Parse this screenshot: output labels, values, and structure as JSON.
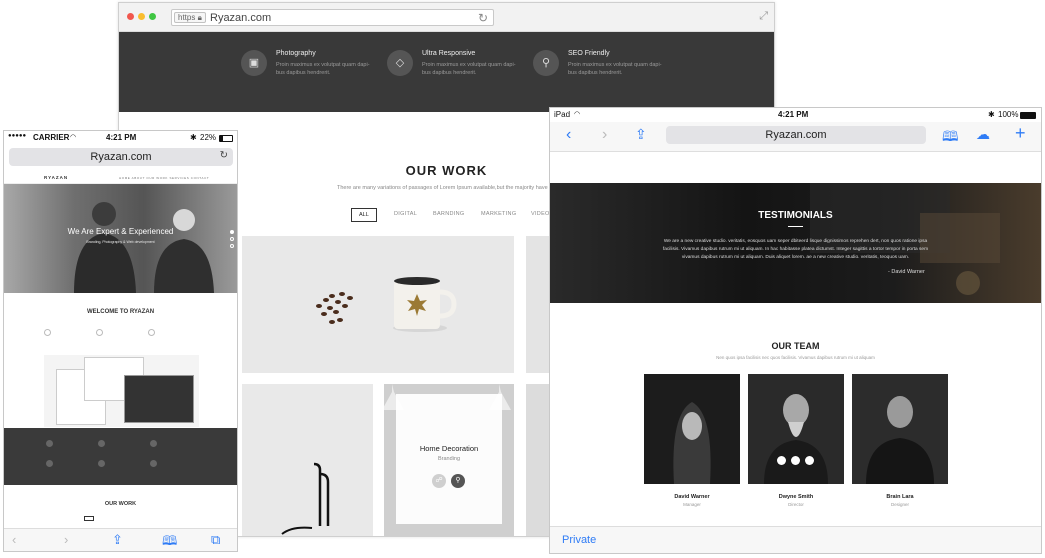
{
  "desktop": {
    "url_scheme": "https",
    "host": "Ryazan.com",
    "features": [
      {
        "icon": "camera-icon",
        "title": "Photography",
        "desc": "Proin maximus ex volutpat quam dapi-bus dapibus hendrerit."
      },
      {
        "icon": "diamond-icon",
        "title": "Ultra Responsive",
        "desc": "Proin maximus ex volutpat quam dapi-bus dapibus hendrerit."
      },
      {
        "icon": "search-icon",
        "title": "SEO Friendly",
        "desc": "Proin maximus ex volutpat quam dapi-bus dapibus hendrerit."
      }
    ],
    "work_title": "OUR WORK",
    "work_subtitle": "There are many variations of passages of Lorem Ipsum available,but the majority have su",
    "filters": [
      "ALL",
      "DIGITAL",
      "BARNDING",
      "MARKETING",
      "VIDEO"
    ],
    "overlay_title": "Home Decoration",
    "overlay_subtitle": "Branding"
  },
  "iphone": {
    "carrier": "CARRIER",
    "time": "4:21 PM",
    "battery": "22%",
    "host": "Ryazan.com",
    "site_logo": "RYAZAN",
    "site_menu": "HOME  ABOUT  OUR WORK  SERVICES  CONTACT",
    "hero_title": "We Are Expert & Experienced",
    "hero_subtitle": "Branding, Photography & Web development",
    "welcome": "WELCOME TO RYAZAN",
    "our_work": "OUR WORK"
  },
  "ipad": {
    "device": "iPad",
    "time": "4:21 PM",
    "battery": "100%",
    "host": "Ryazan.com",
    "testimonials_title": "TESTIMONIALS",
    "testimonial_quote": "We are a new creative studio. veritatis, eosquos uam seper dbiteerd lisque dignissimos reprehen dert, non quos ratione ipsa facilisis. Vivamus dapibus rutrum mi ut aliquam. In hac habitasse platea dictumst. Integer sagittis a tortor tempor in porta sem vivamus dapibus rutrum mi ut aliquam. Duis aliquet lorem. ae a new creative studio. veritatis, teoquos uam.",
    "testimonial_author": "- David Warner",
    "team_title": "OUR TEAM",
    "team_subtitle": "Nen quos ipsa facilisis nec quos facilisis. Vivamus dapibus rutrum mi ut aliquam",
    "team": [
      {
        "name": "David Warner",
        "role": "Manager"
      },
      {
        "name": "Dwyne Smith",
        "role": "Director"
      },
      {
        "name": "Brain Lara",
        "role": "Designer"
      }
    ],
    "private_label": "Private"
  },
  "colors": {
    "ios_blue": "#2f7cf6",
    "dark_band": "#393939",
    "mac_red": "#f1574e",
    "mac_yellow": "#f9bd2e",
    "mac_green": "#3fc642"
  }
}
